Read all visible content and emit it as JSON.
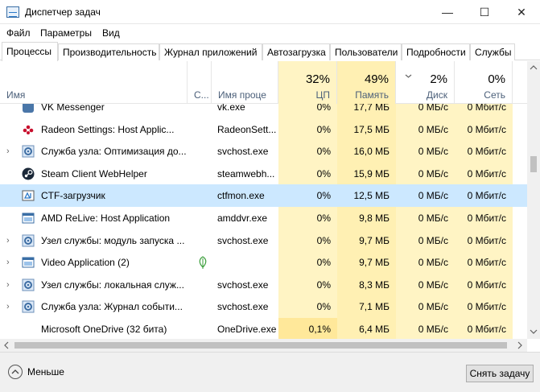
{
  "window": {
    "title": "Диспетчер задач",
    "minimize": "—",
    "maximize": "☐",
    "close": "✕"
  },
  "menu": [
    "Файл",
    "Параметры",
    "Вид"
  ],
  "tabs": [
    "Процессы",
    "Производительность",
    "Журнал приложений",
    "Автозагрузка",
    "Пользователи",
    "Подробности",
    "Службы"
  ],
  "active_tab": "Процессы",
  "columns": {
    "name": "Имя",
    "status": "С...",
    "procname": "Имя проце",
    "cpu": {
      "pct": "32%",
      "label": "ЦП"
    },
    "mem": {
      "pct": "49%",
      "label": "Память"
    },
    "disk": {
      "pct": "2%",
      "label": "Диск"
    },
    "net": {
      "pct": "0%",
      "label": "Сеть"
    }
  },
  "rows": [
    {
      "name": "VK Messenger",
      "proc": "vk.exe",
      "cpu": "0%",
      "mem": "17,7 МБ",
      "disk": "0 МБ/с",
      "net": "0 Мбит/с",
      "expand": "",
      "icon": "vk-icon",
      "eco": ""
    },
    {
      "name": "Radeon Settings: Host Applic...",
      "proc": "RadeonSett...",
      "cpu": "0%",
      "mem": "17,5 МБ",
      "disk": "0 МБ/с",
      "net": "0 Мбит/с",
      "expand": "",
      "icon": "radeon-icon",
      "eco": ""
    },
    {
      "name": "Служба узла: Оптимизация до...",
      "proc": "svchost.exe",
      "cpu": "0%",
      "mem": "16,0 МБ",
      "disk": "0 МБ/с",
      "net": "0 Мбит/с",
      "expand": "›",
      "icon": "gear-icon",
      "eco": ""
    },
    {
      "name": "Steam Client WebHelper",
      "proc": "steamwebh...",
      "cpu": "0%",
      "mem": "15,9 МБ",
      "disk": "0 МБ/с",
      "net": "0 Мбит/с",
      "expand": "",
      "icon": "steam-icon",
      "eco": ""
    },
    {
      "name": "CTF-загрузчик",
      "proc": "ctfmon.exe",
      "cpu": "0%",
      "mem": "12,5 МБ",
      "disk": "0 МБ/с",
      "net": "0 Мбит/с",
      "expand": "",
      "icon": "ctf-icon",
      "eco": ""
    },
    {
      "name": "AMD ReLive: Host Application",
      "proc": "amddvr.exe",
      "cpu": "0%",
      "mem": "9,8 МБ",
      "disk": "0 МБ/с",
      "net": "0 Мбит/с",
      "expand": "",
      "icon": "window-icon",
      "eco": ""
    },
    {
      "name": "Узел службы: модуль запуска ...",
      "proc": "svchost.exe",
      "cpu": "0%",
      "mem": "9,7 МБ",
      "disk": "0 МБ/с",
      "net": "0 Мбит/с",
      "expand": "›",
      "icon": "gear-icon",
      "eco": ""
    },
    {
      "name": "Video Application (2)",
      "proc": "",
      "cpu": "0%",
      "mem": "9,7 МБ",
      "disk": "0 МБ/с",
      "net": "0 Мбит/с",
      "expand": "›",
      "icon": "window-icon",
      "eco": "leaf"
    },
    {
      "name": "Узел службы: локальная служ...",
      "proc": "svchost.exe",
      "cpu": "0%",
      "mem": "8,3 МБ",
      "disk": "0 МБ/с",
      "net": "0 Мбит/с",
      "expand": "›",
      "icon": "gear-icon",
      "eco": ""
    },
    {
      "name": "Служба узла: Журнал событи...",
      "proc": "svchost.exe",
      "cpu": "0%",
      "mem": "7,1 МБ",
      "disk": "0 МБ/с",
      "net": "0 Мбит/с",
      "expand": "›",
      "icon": "gear-icon",
      "eco": ""
    },
    {
      "name": "Microsoft OneDrive (32 бита)",
      "proc": "OneDrive.exe",
      "cpu": "0,1%",
      "mem": "6,4 МБ",
      "disk": "0 МБ/с",
      "net": "0 Мбит/с",
      "expand": "",
      "icon": "",
      "eco": ""
    }
  ],
  "selected_row": 4,
  "footer": {
    "less": "Меньше",
    "end_task": "Снять задачу"
  },
  "colors": {
    "selected": "#cce8ff",
    "heat_light": "#fff4c4",
    "heat_mid": "#fff0b3",
    "accent": "#0078d7"
  }
}
